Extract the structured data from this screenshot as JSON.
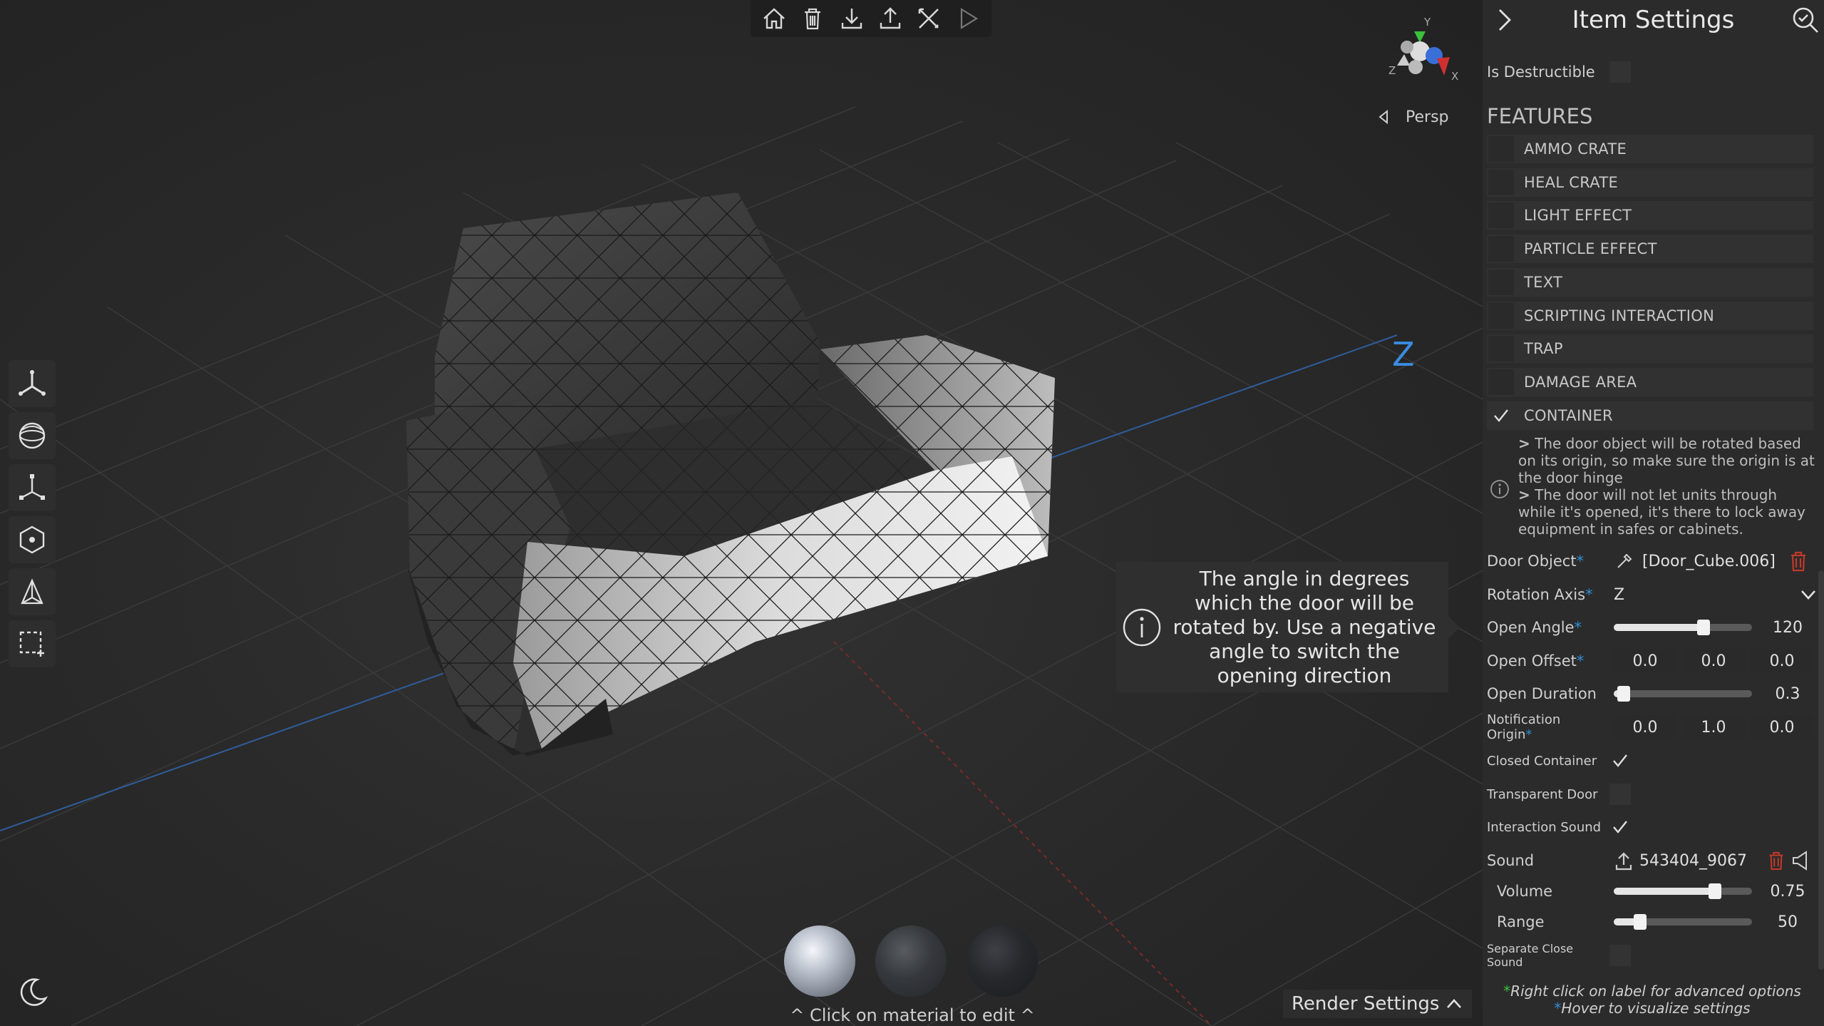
{
  "toolbar": {
    "icons": [
      "home-icon",
      "trash-icon",
      "download-icon",
      "upload-icon",
      "tools-icon",
      "play-icon"
    ]
  },
  "viewport": {
    "gizmo": {
      "y": "Y",
      "z": "Z",
      "x": "X"
    },
    "camera_mode": "Persp",
    "axis_label": "Z",
    "tooltip": "The angle in degrees which the door will be rotated by. Use a negative angle to switch the opening direction",
    "material_hint": "^ Click on material to edit ^",
    "render_settings": "Render Settings"
  },
  "panel": {
    "title": "Item Settings",
    "is_destructible_label": "Is Destructible",
    "is_destructible": false,
    "features_heading": "FEATURES",
    "features": [
      {
        "label": "AMMO CRATE",
        "checked": false
      },
      {
        "label": "HEAL CRATE",
        "checked": false
      },
      {
        "label": "LIGHT EFFECT",
        "checked": false
      },
      {
        "label": "PARTICLE EFFECT",
        "checked": false
      },
      {
        "label": "TEXT",
        "checked": false
      },
      {
        "label": "SCRIPTING INTERACTION",
        "checked": false
      },
      {
        "label": "TRAP",
        "checked": false
      },
      {
        "label": "DAMAGE AREA",
        "checked": false
      },
      {
        "label": "CONTAINER",
        "checked": true
      }
    ],
    "info_line1_marker": ">",
    "info_line1": " The door object will be rotated based on its origin, so make sure the origin is at the door hinge",
    "info_line2_marker": ">",
    "info_line2": " The door will not let units through while it's opened, it's there to lock away equipment in safes or cabinets.",
    "door_object_label": "Door Object",
    "door_object_value": "[Door_Cube.006]",
    "rotation_axis_label": "Rotation Axis",
    "rotation_axis_value": "Z",
    "open_angle_label": "Open Angle",
    "open_angle_value": "120",
    "open_angle_fraction": 0.65,
    "open_offset_label": "Open Offset",
    "open_offset": [
      "0.0",
      "0.0",
      "0.0"
    ],
    "open_duration_label": "Open Duration",
    "open_duration_value": "0.3",
    "open_duration_fraction": 0.07,
    "notification_origin_label": "Notification Origin",
    "notification_origin": [
      "0.0",
      "1.0",
      "0.0"
    ],
    "closed_container_label": "Closed Container",
    "closed_container": true,
    "transparent_door_label": "Transparent Door",
    "transparent_door": false,
    "interaction_sound_label": "Interaction Sound",
    "interaction_sound": true,
    "sound_label": "Sound",
    "sound_value": "543404_9067",
    "volume_label": "Volume",
    "volume_value": "0.75",
    "volume_fraction": 0.73,
    "range_label": "Range",
    "range_value": "50",
    "range_fraction": 0.19,
    "separate_close_sound_label_1": "Separate Close",
    "separate_close_sound_label_2": "Sound",
    "separate_close_sound": false,
    "star": "*",
    "footer_star": "*",
    "footer_line1": "Right click on label for advanced options",
    "footer_line2": "Hover to visualize settings"
  },
  "colors": {
    "accent_blue": "#2e8fd6",
    "accent_green": "#3bc13b",
    "delete_red": "#c0392b"
  }
}
